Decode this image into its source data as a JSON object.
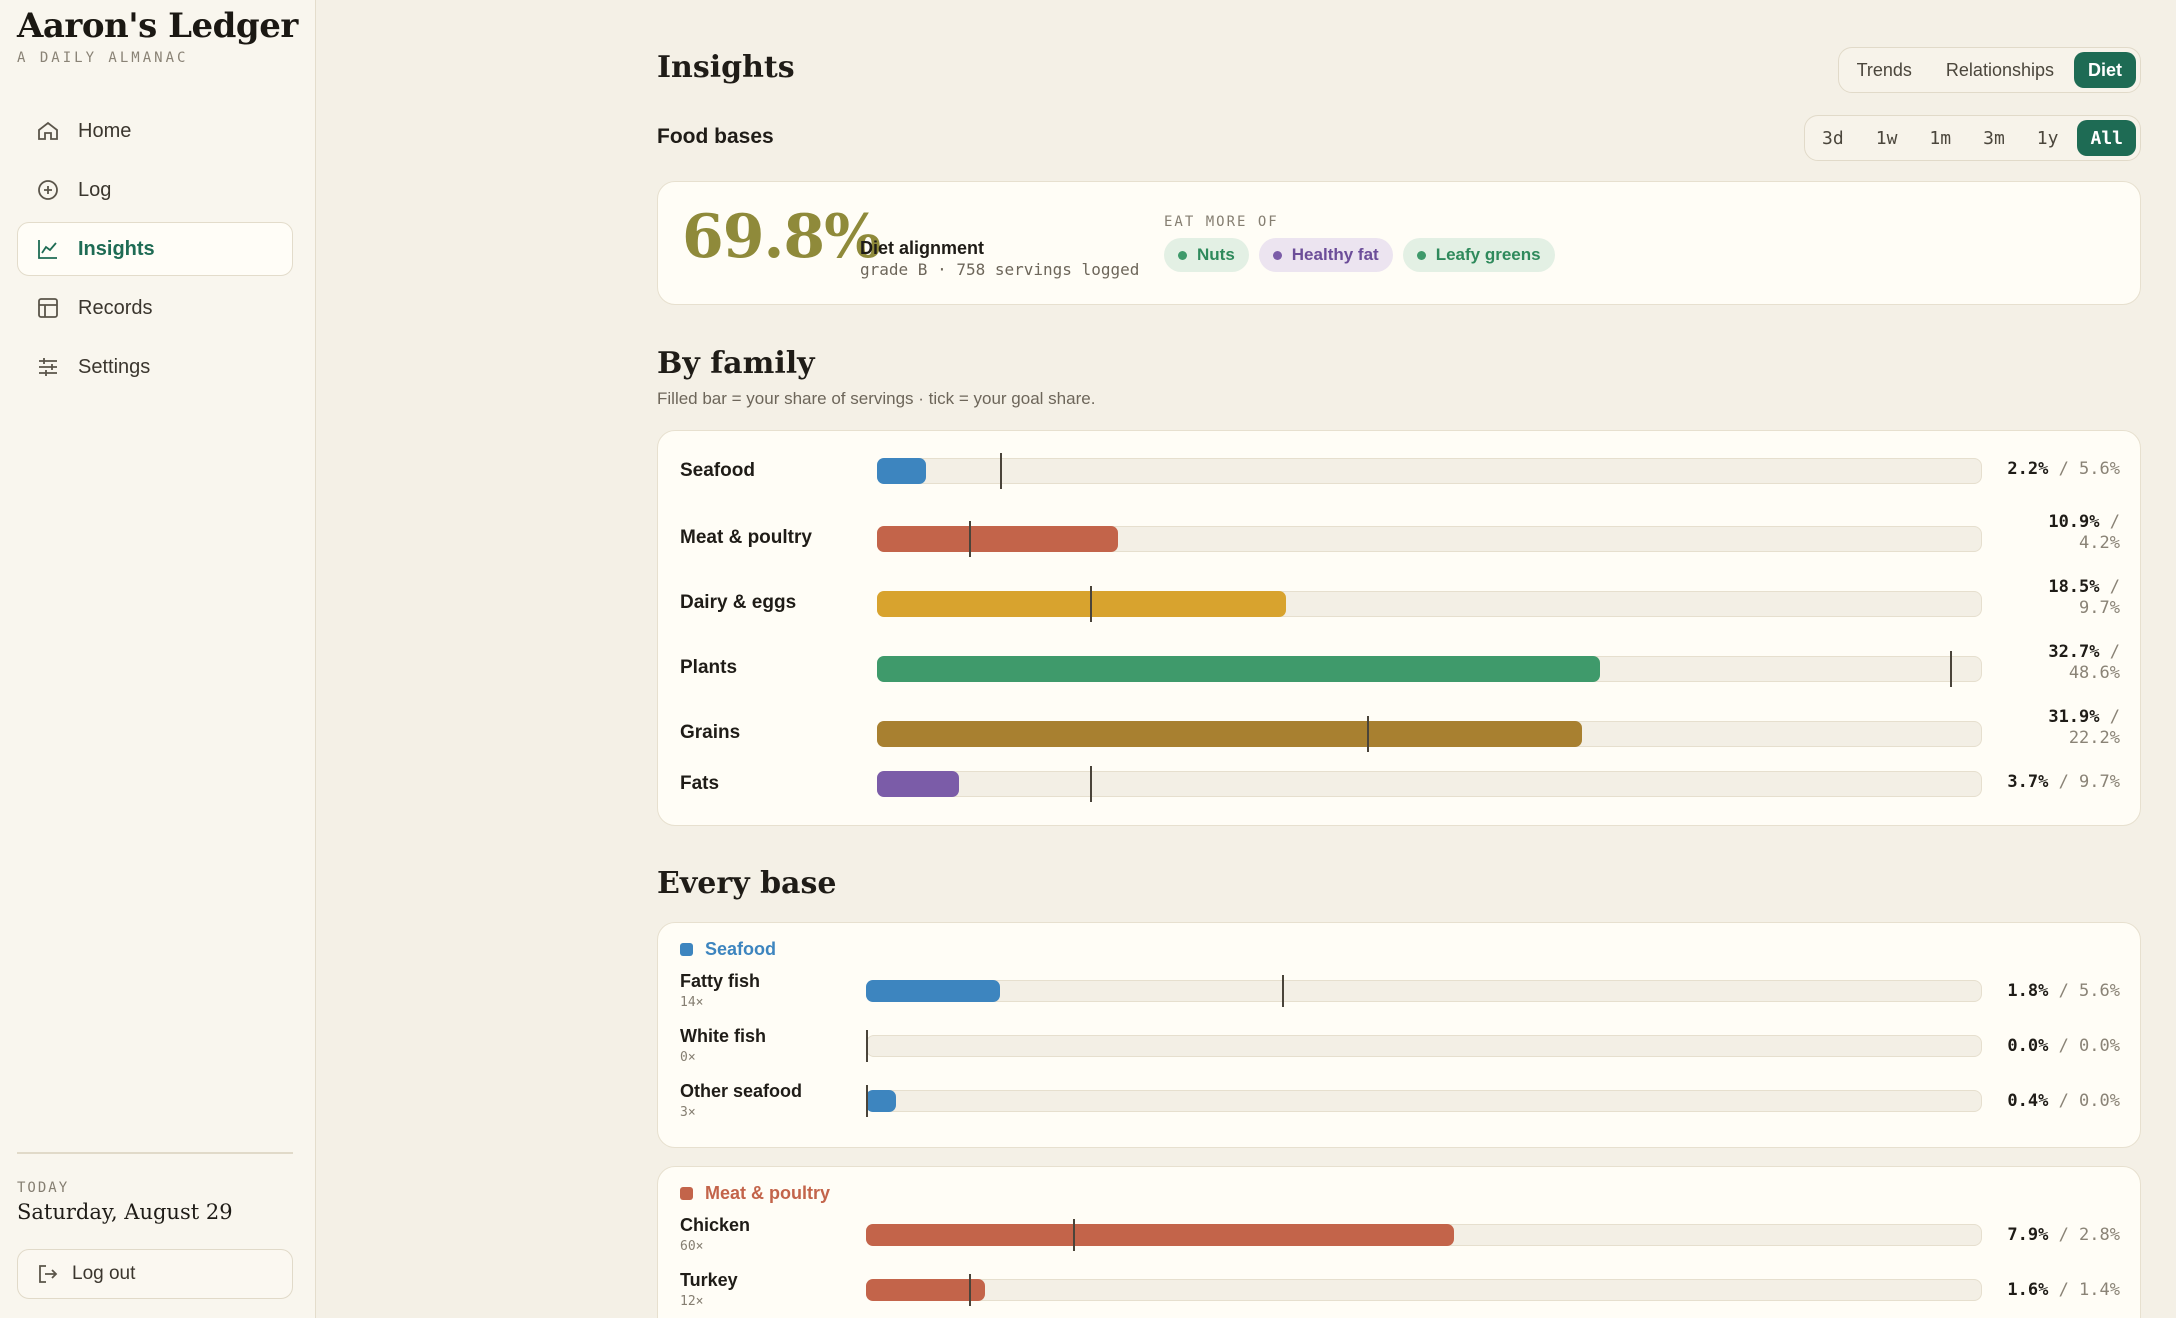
{
  "app": {
    "title": "Aaron's Ledger",
    "subtitle": "A DAILY ALMANAC"
  },
  "sidebar": {
    "items": [
      {
        "label": "Home",
        "icon": "home-icon"
      },
      {
        "label": "Log",
        "icon": "plus-circle-icon"
      },
      {
        "label": "Insights",
        "icon": "chart-icon",
        "active": true
      },
      {
        "label": "Records",
        "icon": "table-icon"
      },
      {
        "label": "Settings",
        "icon": "sliders-icon"
      }
    ],
    "today_label": "TODAY",
    "today_date": "Saturday, August 29",
    "logout_label": "Log out"
  },
  "header": {
    "title": "Insights",
    "tabs": [
      {
        "label": "Trends"
      },
      {
        "label": "Relationships"
      },
      {
        "label": "Diet",
        "active": true
      }
    ],
    "section_label": "Food bases",
    "ranges": [
      {
        "label": "3d"
      },
      {
        "label": "1w"
      },
      {
        "label": "1m"
      },
      {
        "label": "3m"
      },
      {
        "label": "1y"
      },
      {
        "label": "All",
        "active": true
      }
    ]
  },
  "summary": {
    "percent": "69.8%",
    "label": "Diet alignment",
    "sub": "grade B · 758 servings logged",
    "eat_more_label": "EAT MORE OF",
    "chips": [
      {
        "label": "Nuts",
        "color": "#3f9a6b",
        "bg": "#e3f0e4",
        "text": "#2f8a5c"
      },
      {
        "label": "Healthy fat",
        "color": "#7b5ca8",
        "bg": "#ece4f0",
        "text": "#6c4d99"
      },
      {
        "label": "Leafy greens",
        "color": "#3f9a6b",
        "bg": "#e3f0e4",
        "text": "#2f8a5c"
      }
    ]
  },
  "by_family": {
    "title": "By family",
    "subtitle": "Filled bar = your share of servings · tick = your goal share.",
    "rows": [
      {
        "name": "Seafood",
        "share": 2.2,
        "goal": 5.6,
        "share_label": "2.2%",
        "goal_label": "5.6%",
        "color": "#3d85bf"
      },
      {
        "name": "Meat & poultry",
        "share": 10.9,
        "goal": 4.2,
        "share_label": "10.9%",
        "goal_label": "4.2%",
        "color": "#c3644a"
      },
      {
        "name": "Dairy & eggs",
        "share": 18.5,
        "goal": 9.7,
        "share_label": "18.5%",
        "goal_label": "9.7%",
        "color": "#d8a32e"
      },
      {
        "name": "Plants",
        "share": 32.7,
        "goal": 48.6,
        "share_label": "32.7%",
        "goal_label": "48.6%",
        "color": "#3f9a6b"
      },
      {
        "name": "Grains",
        "share": 31.9,
        "goal": 22.2,
        "share_label": "31.9%",
        "goal_label": "22.2%",
        "color": "#a88030"
      },
      {
        "name": "Fats",
        "share": 3.7,
        "goal": 9.7,
        "share_label": "3.7%",
        "goal_label": "9.7%",
        "color": "#7b5ca8"
      }
    ]
  },
  "every_base": {
    "title": "Every base",
    "groups": [
      {
        "family": "Seafood",
        "color": "#3d85bf",
        "items": [
          {
            "name": "Fatty fish",
            "count": "14×",
            "share": 1.8,
            "goal": 5.6,
            "share_label": "1.8%",
            "goal_label": "5.6%"
          },
          {
            "name": "White fish",
            "count": "0×",
            "share": 0.0,
            "goal": 0.0,
            "share_label": "0.0%",
            "goal_label": "0.0%"
          },
          {
            "name": "Other seafood",
            "count": "3×",
            "share": 0.4,
            "goal": 0.0,
            "share_label": "0.4%",
            "goal_label": "0.0%"
          }
        ]
      },
      {
        "family": "Meat & poultry",
        "color": "#c3644a",
        "items": [
          {
            "name": "Chicken",
            "count": "60×",
            "share": 7.9,
            "goal": 2.8,
            "share_label": "7.9%",
            "goal_label": "2.8%"
          },
          {
            "name": "Turkey",
            "count": "12×",
            "share": 1.6,
            "goal": 1.4,
            "share_label": "1.6%",
            "goal_label": "1.4%"
          }
        ]
      }
    ]
  }
}
